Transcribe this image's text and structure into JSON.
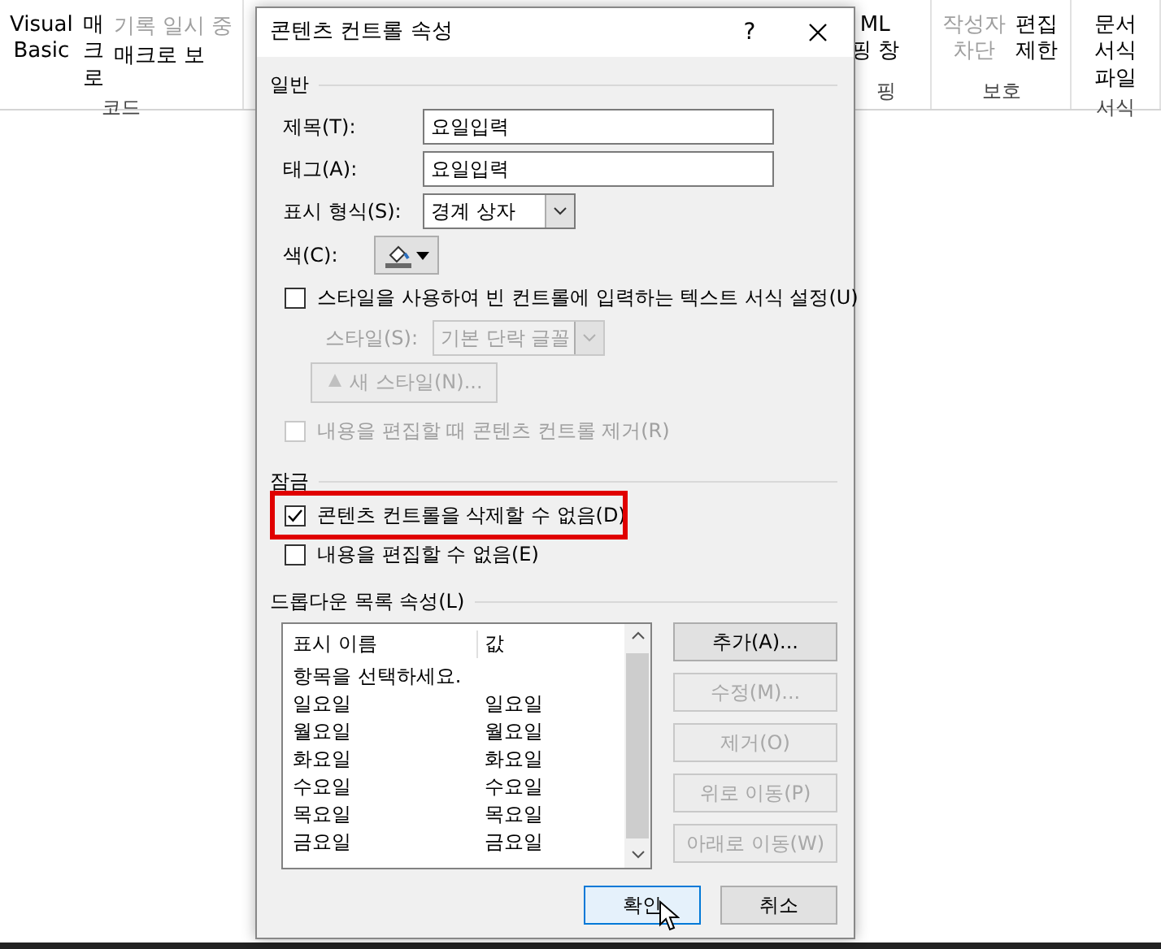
{
  "ribbon": {
    "groups": [
      {
        "label": "코드",
        "items": [
          {
            "kind": "large",
            "label": "Visual\nBasic",
            "disabled": false
          },
          {
            "kind": "large",
            "label": "매크로",
            "disabled": false
          },
          {
            "kind": "small",
            "label": "기록 일시 중",
            "disabled": true
          },
          {
            "kind": "small",
            "label": "매크로 보",
            "disabled": false
          }
        ]
      },
      {
        "label": "핑",
        "items": [
          {
            "kind": "large",
            "label": "ML\n핑 창",
            "disabled": false
          }
        ]
      },
      {
        "label": "보호",
        "items": [
          {
            "kind": "large",
            "label": "작성자\n차단",
            "disabled": true
          },
          {
            "kind": "large",
            "label": "편집\n제한",
            "disabled": false
          }
        ]
      },
      {
        "label": "서식",
        "items": [
          {
            "kind": "large",
            "label": "문서\n서식 파일",
            "disabled": false
          }
        ]
      }
    ]
  },
  "dialog": {
    "title": "콘텐츠 컨트롤 속성",
    "help": "?",
    "general": {
      "label": "일반",
      "title_field": {
        "label": "제목(T):",
        "value": "요일입력"
      },
      "tag_field": {
        "label": "태그(A):",
        "value": "요일입력"
      },
      "show_as": {
        "label": "표시 형식(S):",
        "value": "경계 상자"
      },
      "color": {
        "label": "색(C):"
      },
      "use_style": {
        "label": "스타일을 사용하여 빈 컨트롤에 입력하는 텍스트 서식 설정(U)",
        "checked": false
      },
      "style": {
        "label": "스타일(S):",
        "value": "기본 단락 글꼴",
        "disabled": true
      },
      "new_style": {
        "label": "새 스타일(N)...",
        "disabled": true
      },
      "remove": {
        "label": "내용을 편집할 때 콘텐츠 컨트롤 제거(R)",
        "checked": false,
        "disabled": true
      }
    },
    "locking": {
      "label": "잠금",
      "options": [
        {
          "label": "콘텐츠 컨트롤을 삭제할 수 없음(D)",
          "checked": true,
          "highlighted": true
        },
        {
          "label": "내용을 편집할 수 없음(E)",
          "checked": false,
          "highlighted": false
        }
      ]
    },
    "dropdown": {
      "label": "드롭다운 목록 속성(L)",
      "columns": [
        "표시 이름",
        "값"
      ],
      "rows": [
        {
          "display_name": "항목을 선택하세요.",
          "value": ""
        },
        {
          "display_name": "일요일",
          "value": "일요일"
        },
        {
          "display_name": "월요일",
          "value": "월요일"
        },
        {
          "display_name": "화요일",
          "value": "화요일"
        },
        {
          "display_name": "수요일",
          "value": "수요일"
        },
        {
          "display_name": "목요일",
          "value": "목요일"
        },
        {
          "display_name": "금요일",
          "value": "금요일"
        }
      ],
      "buttons": [
        {
          "label": "추가(A)...",
          "disabled": false
        },
        {
          "label": "수정(M)...",
          "disabled": true
        },
        {
          "label": "제거(O)",
          "disabled": true
        },
        {
          "label": "위로 이동(P)",
          "disabled": true
        },
        {
          "label": "아래로 이동(W)",
          "disabled": true
        }
      ]
    },
    "footer": [
      {
        "label": "확인",
        "default": true
      },
      {
        "label": "취소",
        "default": false
      }
    ]
  }
}
